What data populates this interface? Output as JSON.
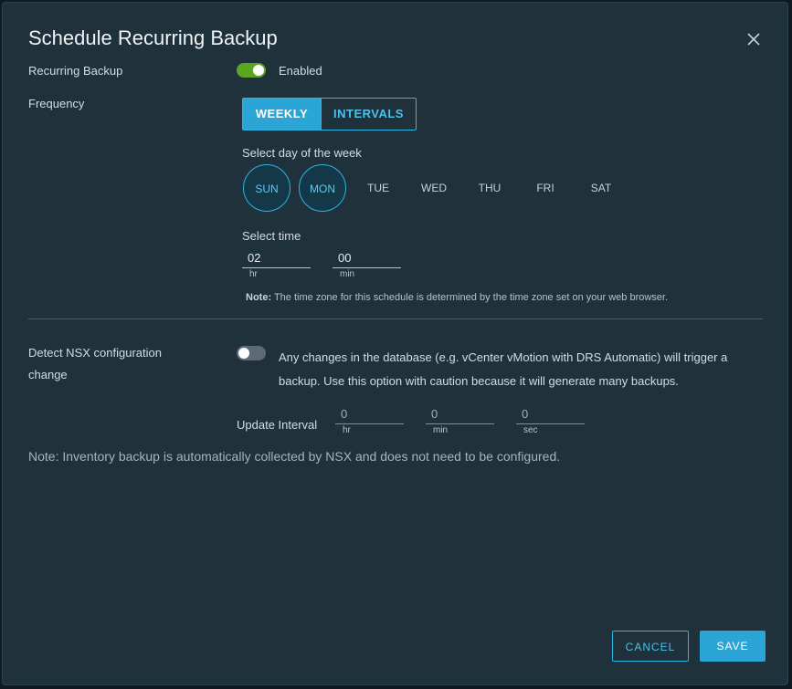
{
  "dialog": {
    "title": "Schedule Recurring Backup"
  },
  "recurring": {
    "label": "Recurring Backup",
    "toggle_text": "Enabled",
    "enabled": true
  },
  "frequency": {
    "label": "Frequency",
    "options": [
      "WEEKLY",
      "INTERVALS"
    ],
    "selected": "WEEKLY"
  },
  "days": {
    "label": "Select day of the week",
    "items": [
      {
        "label": "SUN",
        "selected": true
      },
      {
        "label": "MON",
        "selected": true
      },
      {
        "label": "TUE",
        "selected": false
      },
      {
        "label": "WED",
        "selected": false
      },
      {
        "label": "THU",
        "selected": false
      },
      {
        "label": "FRI",
        "selected": false
      },
      {
        "label": "SAT",
        "selected": false
      }
    ]
  },
  "time": {
    "label": "Select time",
    "hour": {
      "value": "02",
      "unit": "hr"
    },
    "minute": {
      "value": "00",
      "unit": "min"
    },
    "note_prefix": "Note:",
    "note_text": " The time zone for this schedule is determined by the time zone set on your web browser."
  },
  "detect": {
    "label_line1": "Detect NSX configuration",
    "label_line2": "change",
    "enabled": false,
    "description": "Any changes in the database (e.g. vCenter vMotion with DRS Automatic) will trigger a backup. Use this option with caution because it will generate many backups.",
    "interval_label": "Update Interval",
    "interval": [
      {
        "value": "0",
        "unit": "hr"
      },
      {
        "value": "0",
        "unit": "min"
      },
      {
        "value": "0",
        "unit": "sec"
      }
    ]
  },
  "footer_note": "Note: Inventory backup is automatically collected by NSX and does not need to be configured.",
  "buttons": {
    "cancel": "CANCEL",
    "save": "SAVE"
  },
  "colors": {
    "accent": "#2aa5d6",
    "toggle_on": "#5aa620",
    "background": "#1f323c"
  }
}
